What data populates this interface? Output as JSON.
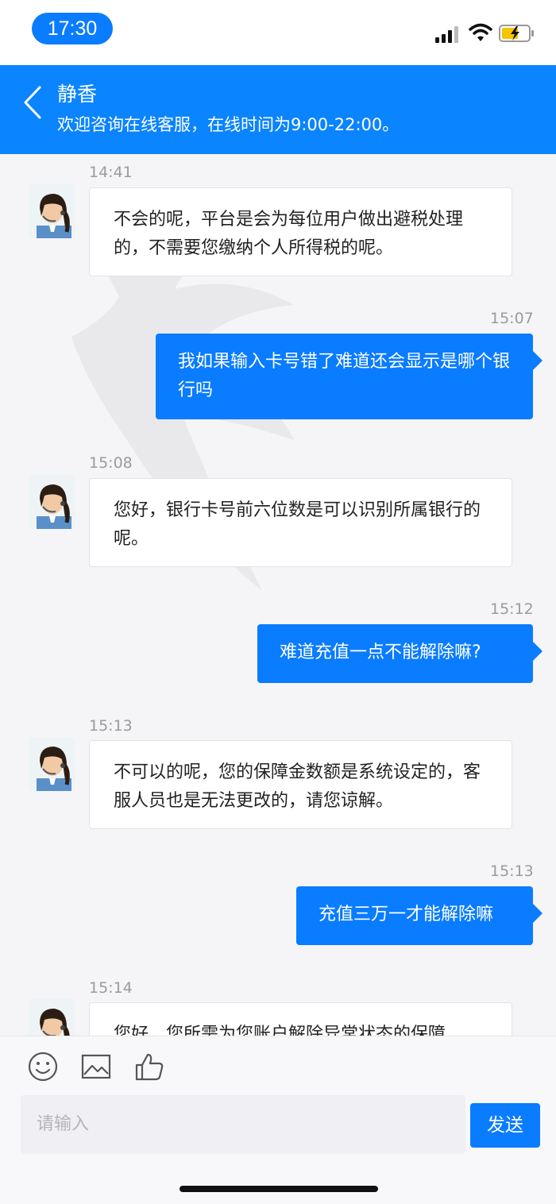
{
  "status": {
    "time": "17:30"
  },
  "header": {
    "title": "静香",
    "subtitle": "欢迎咨询在线客服，在线时间为9:00-22:00。"
  },
  "messages": [
    {
      "from": "agent",
      "time": "14:41",
      "text": "不会的呢，平台是会为每位用户做出避税处理的，不需要您缴纳个人所得税的呢。"
    },
    {
      "from": "user",
      "time": "15:07",
      "text": "我如果输入卡号错了难道还会显示是哪个银行吗"
    },
    {
      "from": "agent",
      "time": "15:08",
      "text": "您好，银行卡号前六位数是可以识别所属银行的呢。"
    },
    {
      "from": "user",
      "time": "15:12",
      "text": "难道充值一点不能解除嘛?"
    },
    {
      "from": "agent",
      "time": "15:13",
      "text": "不可以的呢，您的保障金数额是系统设定的，客服人员也是无法更改的，请您谅解。"
    },
    {
      "from": "user",
      "time": "15:13",
      "text": "充值三万一才能解除嘛"
    },
    {
      "from": "agent",
      "time": "15:14",
      "text": "您好，您所需为您账户解除异常状态的保障"
    }
  ],
  "composer": {
    "placeholder": "请输入",
    "send_label": "发送"
  },
  "icons": [
    "back-icon",
    "emoji-icon",
    "image-icon",
    "thumbs-up-icon",
    "signal-icon",
    "wifi-icon",
    "battery-icon"
  ],
  "colors": {
    "accent": "#0a7cff",
    "header": "#0a84ff"
  }
}
